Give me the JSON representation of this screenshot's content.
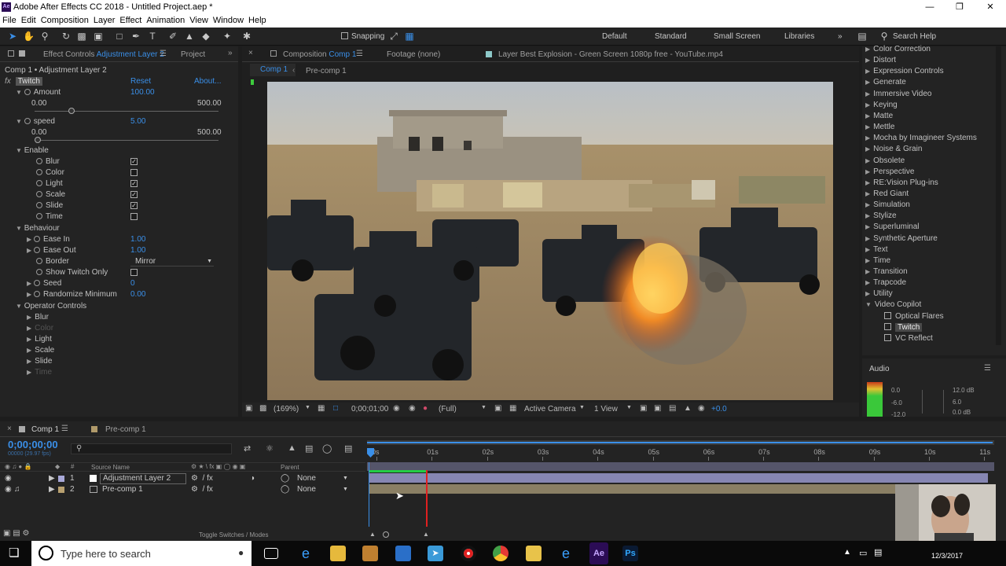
{
  "window": {
    "title": "Adobe After Effects CC 2018 - Untitled Project.aep *",
    "app_icon": "Ae"
  },
  "menu": [
    "File",
    "Edit",
    "Composition",
    "Layer",
    "Effect",
    "Animation",
    "View",
    "Window",
    "Help"
  ],
  "toolbar": {
    "snapping_label": "Snapping",
    "workspaces": [
      "Default",
      "Standard",
      "Small Screen",
      "Libraries"
    ],
    "search_placeholder": "Search Help"
  },
  "effect_controls": {
    "tab_label": "Effect Controls",
    "tab_layer": "Adjustment Layer 2",
    "project_tab": "Project",
    "breadcrumb": "Comp 1 • Adjustment Layer 2",
    "effect_name": "Twitch",
    "reset": "Reset",
    "about": "About...",
    "amount": {
      "label": "Amount",
      "value": "100.00",
      "min": "0.00",
      "max": "500.00"
    },
    "speed": {
      "label": "speed",
      "value": "5.00",
      "min": "0.00",
      "max": "500.00"
    },
    "enable_label": "Enable",
    "enable_items": [
      {
        "label": "Blur",
        "checked": true
      },
      {
        "label": "Color",
        "checked": false
      },
      {
        "label": "Light",
        "checked": true
      },
      {
        "label": "Scale",
        "checked": true
      },
      {
        "label": "Slide",
        "checked": true
      },
      {
        "label": "Time",
        "checked": false
      }
    ],
    "behaviour_label": "Behaviour",
    "ease_in": {
      "label": "Ease In",
      "value": "1.00"
    },
    "ease_out": {
      "label": "Ease Out",
      "value": "1.00"
    },
    "border": {
      "label": "Border",
      "value": "Mirror"
    },
    "show_twitch_only": {
      "label": "Show Twitch Only",
      "checked": false
    },
    "seed": {
      "label": "Seed",
      "value": "0"
    },
    "randomize_minimum": {
      "label": "Randomize Minimum",
      "value": "0.00"
    },
    "operator_label": "Operator Controls",
    "operator_items": [
      "Blur",
      "Color",
      "Light",
      "Scale",
      "Slide",
      "Time"
    ]
  },
  "composition": {
    "tab_label": "Composition",
    "tab_comp": "Comp 1",
    "footage_tab": "Footage (none)",
    "layer_tab": "Layer Best Explosion - Green Screen 1080p free - YouTube.mp4",
    "crumbs": [
      "Comp 1",
      "Pre-comp 1"
    ],
    "zoom": "(169%)",
    "timecode": "0;00;01;00",
    "resolution": "(Full)",
    "camera": "Active Camera",
    "views": "1 View",
    "exposure": "+0.0"
  },
  "effects_list": {
    "categories": [
      "Color Correction",
      "Distort",
      "Expression Controls",
      "Generate",
      "Immersive Video",
      "Keying",
      "Matte",
      "Mettle",
      "Mocha by Imagineer Systems",
      "Noise & Grain",
      "Obsolete",
      "Perspective",
      "RE:Vision Plug-ins",
      "Red Giant",
      "Simulation",
      "Stylize",
      "Superluminal",
      "Synthetic Aperture",
      "Text",
      "Time",
      "Transition",
      "Trapcode",
      "Utility",
      "Video Copilot"
    ],
    "video_copilot_items": [
      "Optical Flares",
      "Twitch",
      "VC Reflect"
    ]
  },
  "audio": {
    "title": "Audio",
    "levels_left": [
      "0.0",
      "-6.0",
      "-12.0"
    ],
    "levels_right": [
      "12.0 dB",
      "6.0",
      "0.0 dB"
    ]
  },
  "timeline": {
    "tabs": [
      "Comp 1",
      "Pre-comp 1"
    ],
    "timecode": "0;00;00;00",
    "fps": "00000 (29.97 fps)",
    "col_source": "Source Name",
    "col_parent": "Parent",
    "ruler": [
      "0s",
      "01s",
      "02s",
      "03s",
      "04s",
      "05s",
      "06s",
      "07s",
      "08s",
      "09s",
      "10s",
      "11s"
    ],
    "layers": [
      {
        "num": "1",
        "name": "Adjustment Layer 2",
        "parent": "None"
      },
      {
        "num": "2",
        "name": "Pre-comp 1",
        "parent": "None"
      }
    ],
    "toggle_label": "Toggle Switches / Modes"
  },
  "taskbar": {
    "search_placeholder": "Type here to search",
    "clock": "12/3/2017"
  }
}
